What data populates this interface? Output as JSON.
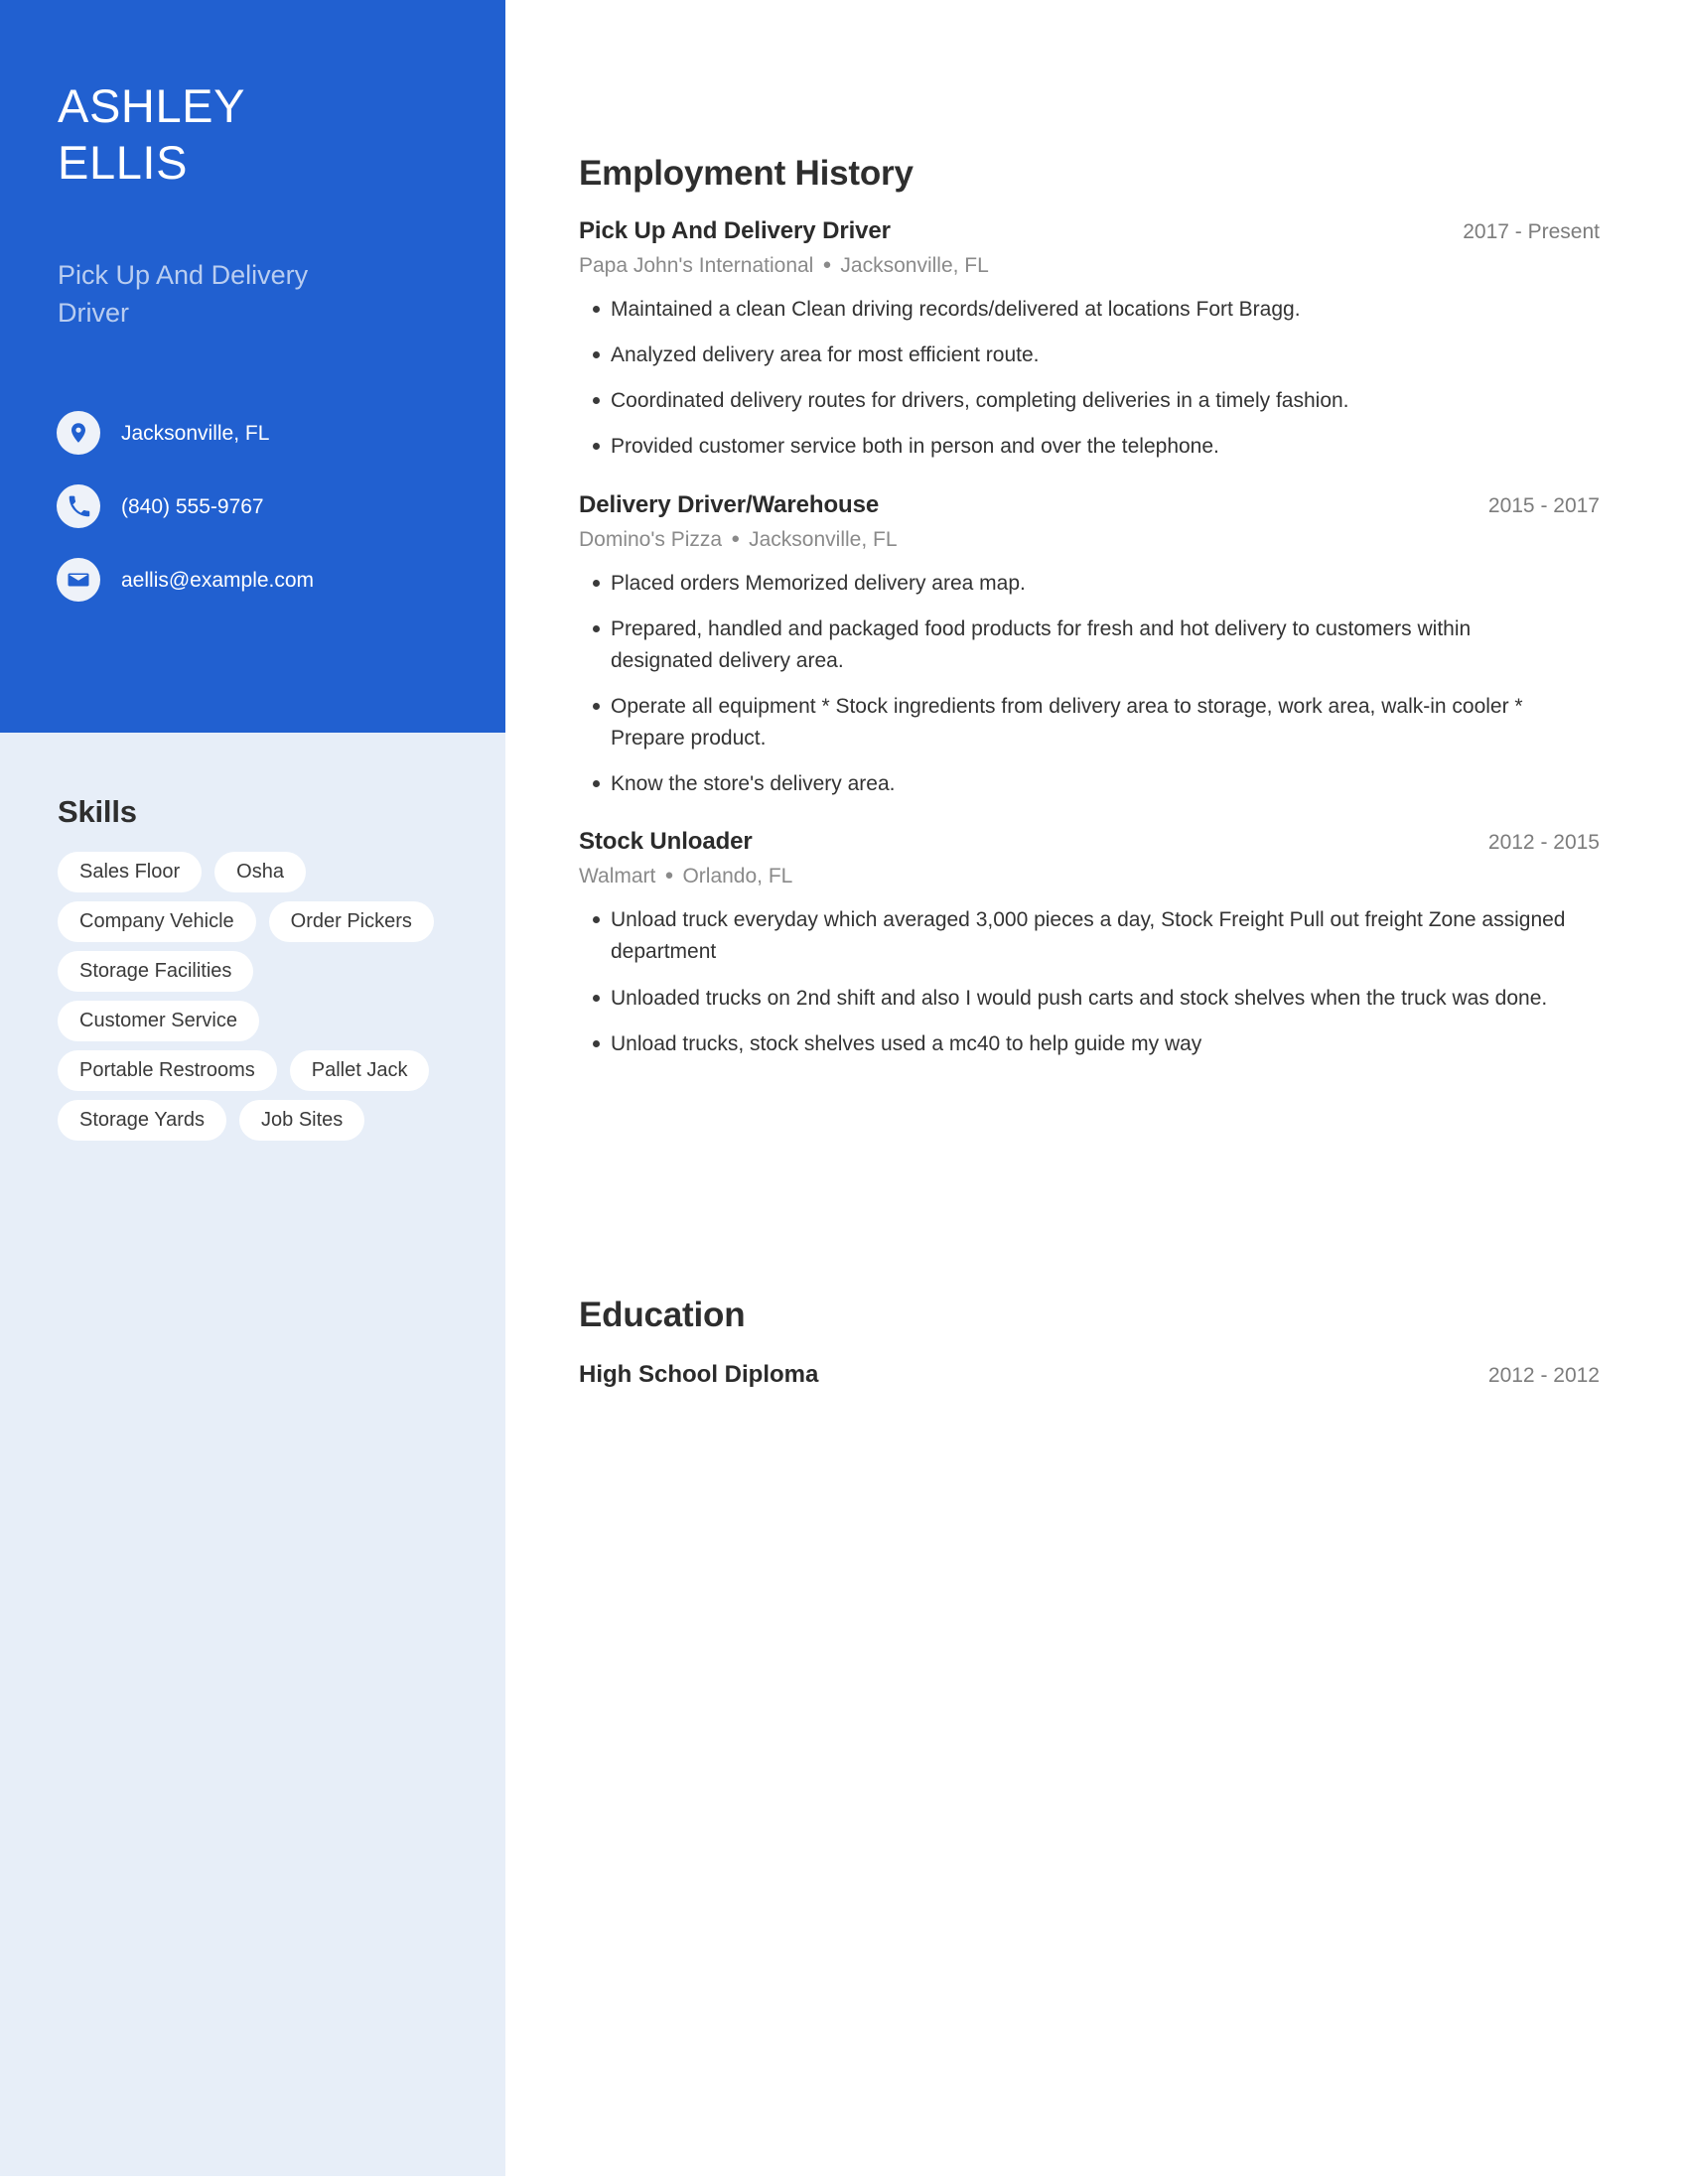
{
  "theme": {
    "accent_blue": "#2160d0",
    "sidebar_bg": "#e7eef8",
    "pill_bg": "#ffffff",
    "subtitle_blue": "#b9cdf0",
    "muted_text": "#8a8a8a"
  },
  "profile": {
    "first_name": "ASHLEY",
    "last_name": "ELLIS",
    "job_title": "Pick Up And Delivery Driver"
  },
  "contact": [
    {
      "icon": "location-pin-icon",
      "value": "Jacksonville, FL"
    },
    {
      "icon": "phone-icon",
      "value": "(840) 555-9767"
    },
    {
      "icon": "envelope-icon",
      "value": "aellis@example.com"
    }
  ],
  "skills": {
    "heading": "Skills",
    "items": [
      "Sales Floor",
      "Osha",
      "Company Vehicle",
      "Order Pickers",
      "Storage Facilities",
      "Customer Service",
      "Portable Restrooms",
      "Pallet Jack",
      "Storage Yards",
      "Job Sites"
    ]
  },
  "employment": {
    "heading": "Employment History",
    "jobs": [
      {
        "title": "Pick Up And Delivery Driver",
        "dates": "2017 - Present",
        "company": "Papa John's International",
        "location": "Jacksonville, FL",
        "bullets": [
          "Maintained a clean Clean driving records/delivered at locations Fort Bragg.",
          "Analyzed delivery area for most efficient route.",
          "Coordinated delivery routes for drivers, completing deliveries in a timely fashion.",
          "Provided customer service both in person and over the telephone."
        ]
      },
      {
        "title": "Delivery Driver/Warehouse",
        "dates": "2015 - 2017",
        "company": "Domino's Pizza",
        "location": "Jacksonville, FL",
        "bullets": [
          "Placed orders Memorized delivery area map.",
          "Prepared, handled and packaged food products for fresh and hot delivery to customers within designated delivery area.",
          "Operate all equipment * Stock ingredients from delivery area to storage, work area, walk-in cooler * Prepare product.",
          "Know the store's delivery area."
        ]
      },
      {
        "title": "Stock Unloader",
        "dates": "2012 - 2015",
        "company": "Walmart",
        "location": "Orlando, FL",
        "bullets": [
          "Unload truck everyday which averaged 3,000 pieces a day, Stock Freight Pull out freight Zone assigned department",
          "Unloaded trucks on 2nd shift and also I would push carts and stock shelves when the truck was done.",
          "Unload trucks, stock shelves used a mc40 to help guide my way"
        ]
      }
    ]
  },
  "education": {
    "heading": "Education",
    "entries": [
      {
        "degree": "High School Diploma",
        "dates": "2012 - 2012"
      }
    ]
  }
}
